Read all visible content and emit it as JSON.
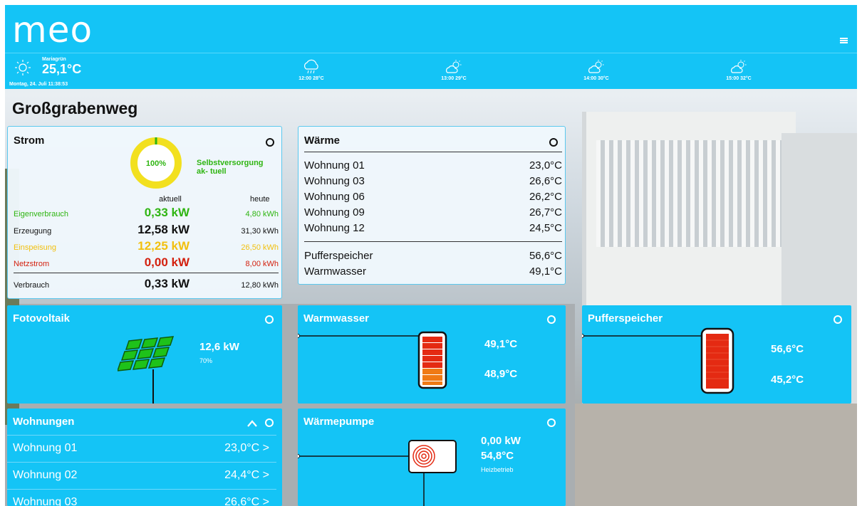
{
  "app": {
    "logo": "meo"
  },
  "weather": {
    "location": "Mariagrün",
    "temperature": "25,1°C",
    "datetime": "Montag, 24. Juli 11:38:53",
    "forecast": [
      {
        "label": "12:00 28°C",
        "icon": "cloud-rain-icon"
      },
      {
        "label": "13:00 29°C",
        "icon": "partly-sunny-icon"
      },
      {
        "label": "14:00 30°C",
        "icon": "partly-sunny-icon"
      },
      {
        "label": "15:00 32°C",
        "icon": "partly-sunny-icon"
      }
    ]
  },
  "page": {
    "title": "Großgrabenweg"
  },
  "strom": {
    "title": "Strom",
    "autarky_percent": "100%",
    "autarky_value": 1.0,
    "autarky_label": "Selbstversorgung ak- tuell",
    "col_now": "aktuell",
    "col_today": "heute",
    "rows": [
      {
        "label": "Eigenverbrauch",
        "now": "0,33 kW",
        "today": "4,80 kWh"
      },
      {
        "label": "Erzeugung",
        "now": "12,58 kW",
        "today": "31,30 kWh"
      },
      {
        "label": "Einspeisung",
        "now": "12,25 kW",
        "today": "26,50 kWh"
      },
      {
        "label": "Netzstrom",
        "now": "0,00 kW",
        "today": "8,00 kWh"
      }
    ],
    "total": {
      "label": "Verbrauch",
      "now": "0,33 kW",
      "today": "12,80 kWh"
    },
    "colors": {
      "green": "#2fb512",
      "yellow": "#f2c00f",
      "red": "#d3200e"
    }
  },
  "waerme": {
    "title": "Wärme",
    "apartments": [
      {
        "label": "Wohnung 01",
        "value": "23,0°C"
      },
      {
        "label": "Wohnung 03",
        "value": "26,6°C"
      },
      {
        "label": "Wohnung 06",
        "value": "26,2°C"
      },
      {
        "label": "Wohnung 09",
        "value": "26,7°C"
      },
      {
        "label": "Wohnung 12",
        "value": "24,5°C"
      }
    ],
    "storage": [
      {
        "label": "Pufferspeicher",
        "value": "56,6°C"
      },
      {
        "label": "Warmwasser",
        "value": "49,1°C"
      }
    ]
  },
  "fotovoltaik": {
    "title": "Fotovoltaik",
    "power": "12,6 kW",
    "percent": "70%"
  },
  "warmwasser": {
    "title": "Warmwasser",
    "top_temp": "49,1°C",
    "bottom_temp": "48,9°C"
  },
  "pufferspeicher": {
    "title": "Pufferspeicher",
    "top_temp": "56,6°C",
    "bottom_temp": "45,2°C"
  },
  "wohnungen": {
    "title": "Wohnungen",
    "items": [
      {
        "label": "Wohnung 01",
        "value": "23,0°C >"
      },
      {
        "label": "Wohnung 02",
        "value": "24,4°C >"
      },
      {
        "label": "Wohnung 03",
        "value": "26,6°C >"
      }
    ]
  },
  "waermepumpe": {
    "title": "Wärmepumpe",
    "power": "0,00 kW",
    "temp": "54,8°C",
    "mode": "Heizbetrieb"
  },
  "theme": {
    "accent": "#14c4f6"
  }
}
